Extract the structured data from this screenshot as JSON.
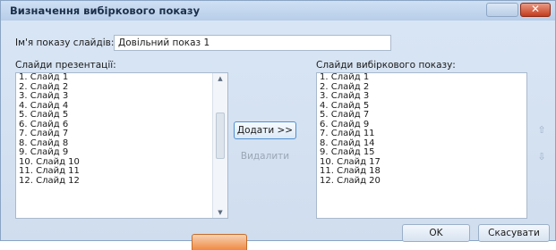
{
  "window": {
    "title": "Визначення вибіркового показу",
    "close_glyph": "✕"
  },
  "name_field": {
    "label": "Ім'я показу слайдів:",
    "value": "Довільний показ 1"
  },
  "left_panel": {
    "label": "Слайди презентації:",
    "items": [
      "1. Слайд 1",
      "2. Слайд 2",
      "3. Слайд 3",
      "4. Слайд 4",
      "5. Слайд 5",
      "6. Слайд 6",
      "7. Слайд 7",
      "8. Слайд 8",
      "9. Слайд 9",
      "10. Слайд 10",
      "11. Слайд 11",
      "12. Слайд 12"
    ]
  },
  "right_panel": {
    "label": "Слайди вибіркового показу:",
    "items": [
      "1. Слайд 1",
      "2. Слайд 2",
      "3. Слайд 3",
      "4. Слайд 5",
      "5. Слайд 7",
      "6. Слайд 9",
      "7. Слайд 11",
      "8. Слайд 14",
      "9. Слайд 15",
      "10. Слайд 17",
      "11. Слайд 18",
      "12. Слайд 20"
    ]
  },
  "buttons": {
    "add": "Додати >>",
    "remove": "Видалити",
    "ok": "OK",
    "cancel": "Скасувати",
    "move_up_glyph": "⇧",
    "move_down_glyph": "⇩"
  },
  "scrollbar": {
    "up_glyph": "▲",
    "down_glyph": "▼"
  },
  "icons": [
    "minimize-icon",
    "close-icon",
    "arrow-up-icon",
    "arrow-down-icon",
    "powerpoint-icon"
  ],
  "colors": {
    "accent": "#4f8fd0",
    "close": "#c43b1c",
    "app_icon": "#f08a42"
  }
}
